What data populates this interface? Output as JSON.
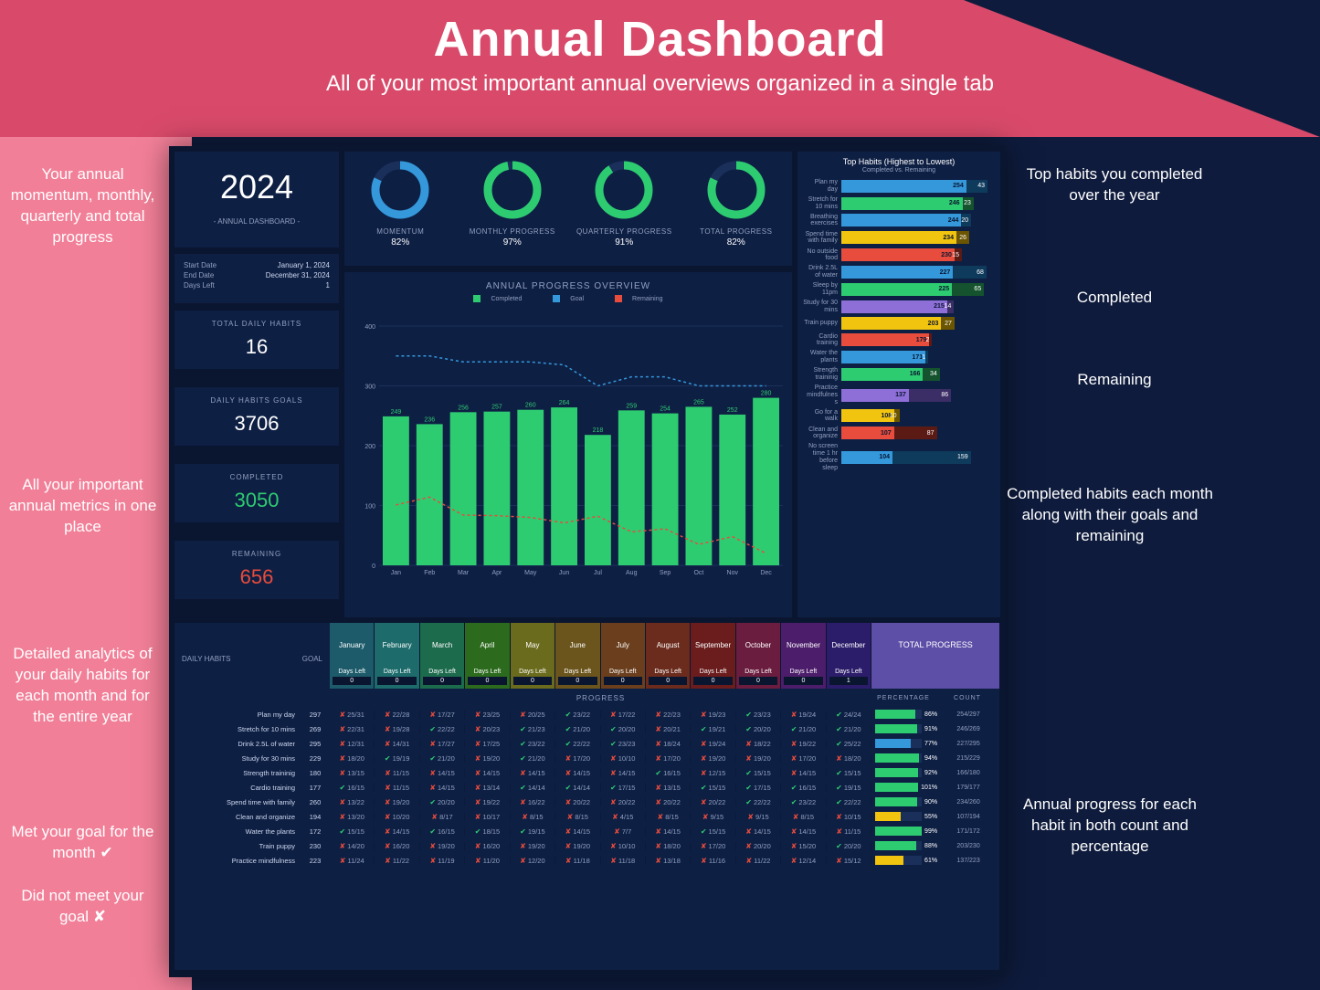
{
  "header": {
    "title": "Annual Dashboard",
    "subtitle": "All of your most important annual overviews organized in a single tab"
  },
  "year_panel": {
    "year": "2024",
    "subtitle": "- ANNUAL DASHBOARD -"
  },
  "dates": {
    "start_label": "Start Date",
    "start_value": "January 1, 2024",
    "end_label": "End Date",
    "end_value": "December 31, 2024",
    "days_left_label": "Days Left",
    "days_left_value": "1"
  },
  "metrics": [
    {
      "label": "TOTAL DAILY HABITS",
      "value": "16",
      "color": "#ffffff"
    },
    {
      "label": "DAILY HABITS GOALS",
      "value": "3706",
      "color": "#ffffff"
    },
    {
      "label": "COMPLETED",
      "value": "3050",
      "color": "#2ecc71"
    },
    {
      "label": "REMAINING",
      "value": "656",
      "color": "#e74c3c"
    }
  ],
  "donuts": [
    {
      "label": "MOMENTUM",
      "value": "82%",
      "pct": 82,
      "color": "#3498db"
    },
    {
      "label": "MONTHLY PROGRESS",
      "value": "97%",
      "pct": 97,
      "color": "#2ecc71"
    },
    {
      "label": "QUARTERLY PROGRESS",
      "value": "91%",
      "pct": 91,
      "color": "#2ecc71"
    },
    {
      "label": "TOTAL PROGRESS",
      "value": "82%",
      "pct": 82,
      "color": "#2ecc71"
    }
  ],
  "chart_data": {
    "type": "bar",
    "title": "ANNUAL PROGRESS OVERVIEW",
    "legend": [
      "Completed",
      "Goal",
      "Remaining"
    ],
    "categories": [
      "Jan",
      "Feb",
      "Mar",
      "Apr",
      "May",
      "Jun",
      "Jul",
      "Aug",
      "Sep",
      "Oct",
      "Nov",
      "Dec"
    ],
    "series": [
      {
        "name": "Completed",
        "color": "#2ecc71",
        "values": [
          249,
          236,
          256,
          257,
          260,
          264,
          218,
          259,
          254,
          265,
          252,
          280
        ]
      },
      {
        "name": "Goal",
        "color": "#3498db",
        "values": [
          350,
          350,
          340,
          340,
          340,
          335,
          300,
          315,
          315,
          300,
          300,
          300
        ]
      },
      {
        "name": "Remaining",
        "color": "#e74c3c",
        "values": [
          101,
          114,
          84,
          83,
          80,
          71,
          82,
          56,
          61,
          35,
          48,
          20
        ]
      }
    ],
    "ylim": [
      0,
      400
    ],
    "yticks": [
      0,
      100,
      200,
      300,
      400
    ]
  },
  "top_habits": {
    "title": "Top Habits (Highest to Lowest)",
    "subtitle": "Completed vs. Remaining",
    "rows": [
      {
        "label": "Plan my day",
        "completed": 254,
        "remaining": 43,
        "c1": "#3498db",
        "c2": "#0e3a5c"
      },
      {
        "label": "Stretch for 10 mins",
        "completed": 246,
        "remaining": 23,
        "c1": "#2ecc71",
        "c2": "#14532d"
      },
      {
        "label": "Breathing exercises",
        "completed": 244,
        "remaining": 20,
        "c1": "#3498db",
        "c2": "#0e3a5c"
      },
      {
        "label": "Spend time with family",
        "completed": 234,
        "remaining": 26,
        "c1": "#f1c40f",
        "c2": "#6b5500"
      },
      {
        "label": "No outside food",
        "completed": 230,
        "remaining": 15,
        "c1": "#e74c3c",
        "c2": "#5c1a14"
      },
      {
        "label": "Drink 2.5L of water",
        "completed": 227,
        "remaining": 68,
        "c1": "#3498db",
        "c2": "#0e3a5c"
      },
      {
        "label": "Sleep by 11pm",
        "completed": 225,
        "remaining": 65,
        "c1": "#2ecc71",
        "c2": "#14532d"
      },
      {
        "label": "Study for 30 mins",
        "completed": 215,
        "remaining": 14,
        "c1": "#8e6fd8",
        "c2": "#3b2d66"
      },
      {
        "label": "Train puppy",
        "completed": 203,
        "remaining": 27,
        "c1": "#f1c40f",
        "c2": "#6b5500"
      },
      {
        "label": "Cardio training",
        "completed": 179,
        "remaining": 2,
        "c1": "#e74c3c",
        "c2": "#5c1a14"
      },
      {
        "label": "Water the plants",
        "completed": 171,
        "remaining": 1,
        "c1": "#3498db",
        "c2": "#0e3a5c"
      },
      {
        "label": "Strength traininig",
        "completed": 166,
        "remaining": 34,
        "c1": "#2ecc71",
        "c2": "#14532d"
      },
      {
        "label": "Practice mindfulnes s",
        "completed": 137,
        "remaining": 86,
        "c1": "#8e6fd8",
        "c2": "#3b2d66"
      },
      {
        "label": "Go for a walk",
        "completed": 108,
        "remaining": 10,
        "c1": "#f1c40f",
        "c2": "#6b5500"
      },
      {
        "label": "Clean and organize",
        "completed": 107,
        "remaining": 87,
        "c1": "#e74c3c",
        "c2": "#5c1a14"
      },
      {
        "label": "No screen time 1 hr before sleep",
        "completed": 104,
        "remaining": 159,
        "c1": "#3498db",
        "c2": "#0e3a5c"
      }
    ]
  },
  "month_headers": {
    "months": [
      "January",
      "February",
      "March",
      "April",
      "May",
      "June",
      "July",
      "August",
      "September",
      "October",
      "November",
      "December"
    ],
    "colors": [
      "#1d5b6b",
      "#1d6b6b",
      "#1d6b4d",
      "#2c6b1d",
      "#6b6b1d",
      "#6b551d",
      "#6b3f1d",
      "#6b2c1d",
      "#6b1d1d",
      "#6b1d3f",
      "#4c1d6b",
      "#2c1d6b"
    ],
    "days_left_label": "Days Left",
    "days_left": [
      "0",
      "0",
      "0",
      "0",
      "0",
      "0",
      "0",
      "0",
      "0",
      "0",
      "0",
      "1"
    ],
    "left_label": "DAILY HABITS",
    "goal_label": "GOAL",
    "total_label": "TOTAL PROGRESS",
    "progress_label": "PROGRESS",
    "pct_label": "PERCENTAGE",
    "count_label": "COUNT"
  },
  "habit_rows": [
    {
      "name": "Plan my day",
      "goal": 297,
      "cells": [
        [
          "x",
          "25/31"
        ],
        [
          "x",
          "22/28"
        ],
        [
          "x",
          "17/27"
        ],
        [
          "x",
          "23/25"
        ],
        [
          "x",
          "20/25"
        ],
        [
          "v",
          "23/22"
        ],
        [
          "x",
          "17/22"
        ],
        [
          "x",
          "22/23"
        ],
        [
          "x",
          "19/23"
        ],
        [
          "v",
          "23/23"
        ],
        [
          "x",
          "19/24"
        ],
        [
          "v",
          "24/24"
        ]
      ],
      "pct": 86,
      "count": "254/297"
    },
    {
      "name": "Stretch for 10 mins",
      "goal": 269,
      "cells": [
        [
          "x",
          "22/31"
        ],
        [
          "x",
          "19/28"
        ],
        [
          "v",
          "22/22"
        ],
        [
          "x",
          "20/23"
        ],
        [
          "v",
          "21/23"
        ],
        [
          "v",
          "21/20"
        ],
        [
          "v",
          "20/20"
        ],
        [
          "x",
          "20/21"
        ],
        [
          "v",
          "19/21"
        ],
        [
          "v",
          "20/20"
        ],
        [
          "v",
          "21/20"
        ],
        [
          "v",
          "21/20"
        ]
      ],
      "pct": 91,
      "count": "246/269"
    },
    {
      "name": "Drink 2.5L of water",
      "goal": 295,
      "cells": [
        [
          "x",
          "12/31"
        ],
        [
          "x",
          "14/31"
        ],
        [
          "x",
          "17/27"
        ],
        [
          "x",
          "17/25"
        ],
        [
          "v",
          "23/22"
        ],
        [
          "v",
          "22/22"
        ],
        [
          "v",
          "23/23"
        ],
        [
          "x",
          "18/24"
        ],
        [
          "x",
          "19/24"
        ],
        [
          "x",
          "18/22"
        ],
        [
          "x",
          "19/22"
        ],
        [
          "v",
          "25/22"
        ]
      ],
      "pct": 77,
      "count": "227/295"
    },
    {
      "name": "Study for 30 mins",
      "goal": 229,
      "cells": [
        [
          "x",
          "18/20"
        ],
        [
          "v",
          "19/19"
        ],
        [
          "v",
          "21/20"
        ],
        [
          "x",
          "19/20"
        ],
        [
          "v",
          "21/20"
        ],
        [
          "x",
          "17/20"
        ],
        [
          "x",
          "10/10"
        ],
        [
          "x",
          "17/20"
        ],
        [
          "x",
          "19/20"
        ],
        [
          "x",
          "19/20"
        ],
        [
          "x",
          "17/20"
        ],
        [
          "x",
          "18/20"
        ]
      ],
      "pct": 94,
      "count": "215/229"
    },
    {
      "name": "Strength traininig",
      "goal": 180,
      "cells": [
        [
          "x",
          "13/15"
        ],
        [
          "x",
          "11/15"
        ],
        [
          "x",
          "14/15"
        ],
        [
          "x",
          "14/15"
        ],
        [
          "x",
          "14/15"
        ],
        [
          "x",
          "14/15"
        ],
        [
          "x",
          "14/15"
        ],
        [
          "v",
          "16/15"
        ],
        [
          "x",
          "12/15"
        ],
        [
          "v",
          "15/15"
        ],
        [
          "x",
          "14/15"
        ],
        [
          "v",
          "15/15"
        ]
      ],
      "pct": 92,
      "count": "166/180"
    },
    {
      "name": "Cardio training",
      "goal": 177,
      "cells": [
        [
          "v",
          "16/15"
        ],
        [
          "x",
          "11/15"
        ],
        [
          "x",
          "14/15"
        ],
        [
          "x",
          "13/14"
        ],
        [
          "v",
          "14/14"
        ],
        [
          "v",
          "14/14"
        ],
        [
          "v",
          "17/15"
        ],
        [
          "x",
          "13/15"
        ],
        [
          "v",
          "15/15"
        ],
        [
          "v",
          "17/15"
        ],
        [
          "v",
          "16/15"
        ],
        [
          "v",
          "19/15"
        ]
      ],
      "pct": 101,
      "count": "179/177"
    },
    {
      "name": "Spend time with family",
      "goal": 260,
      "cells": [
        [
          "x",
          "13/22"
        ],
        [
          "x",
          "19/20"
        ],
        [
          "v",
          "20/20"
        ],
        [
          "x",
          "19/22"
        ],
        [
          "x",
          "16/22"
        ],
        [
          "x",
          "20/22"
        ],
        [
          "x",
          "20/22"
        ],
        [
          "x",
          "20/22"
        ],
        [
          "x",
          "20/22"
        ],
        [
          "v",
          "22/22"
        ],
        [
          "v",
          "23/22"
        ],
        [
          "v",
          "22/22"
        ]
      ],
      "pct": 90,
      "count": "234/260"
    },
    {
      "name": "Clean and organize",
      "goal": 194,
      "cells": [
        [
          "x",
          "13/20"
        ],
        [
          "x",
          "10/20"
        ],
        [
          "x",
          "8/17"
        ],
        [
          "x",
          "10/17"
        ],
        [
          "x",
          "8/15"
        ],
        [
          "x",
          "8/15"
        ],
        [
          "x",
          "4/15"
        ],
        [
          "x",
          "8/15"
        ],
        [
          "x",
          "9/15"
        ],
        [
          "x",
          "9/15"
        ],
        [
          "x",
          "8/15"
        ],
        [
          "x",
          "10/15"
        ]
      ],
      "pct": 55,
      "count": "107/194"
    },
    {
      "name": "Water the plants",
      "goal": 172,
      "cells": [
        [
          "v",
          "15/15"
        ],
        [
          "x",
          "14/15"
        ],
        [
          "v",
          "16/15"
        ],
        [
          "v",
          "18/15"
        ],
        [
          "v",
          "19/15"
        ],
        [
          "x",
          "14/15"
        ],
        [
          "x",
          "7/7"
        ],
        [
          "x",
          "14/15"
        ],
        [
          "v",
          "15/15"
        ],
        [
          "x",
          "14/15"
        ],
        [
          "x",
          "14/15"
        ],
        [
          "x",
          "11/15"
        ]
      ],
      "pct": 99,
      "count": "171/172"
    },
    {
      "name": "Train puppy",
      "goal": 230,
      "cells": [
        [
          "x",
          "14/20"
        ],
        [
          "x",
          "16/20"
        ],
        [
          "x",
          "19/20"
        ],
        [
          "x",
          "16/20"
        ],
        [
          "x",
          "19/20"
        ],
        [
          "x",
          "19/20"
        ],
        [
          "x",
          "10/10"
        ],
        [
          "x",
          "18/20"
        ],
        [
          "x",
          "17/20"
        ],
        [
          "x",
          "20/20"
        ],
        [
          "x",
          "15/20"
        ],
        [
          "v",
          "20/20"
        ]
      ],
      "pct": 88,
      "count": "203/230"
    },
    {
      "name": "Practice mindfulness",
      "goal": 223,
      "cells": [
        [
          "x",
          "11/24"
        ],
        [
          "x",
          "11/22"
        ],
        [
          "x",
          "11/19"
        ],
        [
          "x",
          "11/20"
        ],
        [
          "x",
          "12/20"
        ],
        [
          "x",
          "11/18"
        ],
        [
          "x",
          "11/18"
        ],
        [
          "x",
          "13/18"
        ],
        [
          "x",
          "11/16"
        ],
        [
          "x",
          "11/22"
        ],
        [
          "x",
          "12/14"
        ],
        [
          "x",
          "15/12"
        ]
      ],
      "pct": 61,
      "count": "137/223"
    }
  ],
  "callouts": {
    "c1": "Your annual momentum, monthly, quarterly and total progress",
    "c2": "All your important annual metrics in one place",
    "c3": "Detailed analytics of your daily habits for each month and for the entire year",
    "c4": "Met your goal for the month ✔",
    "c5": "Did not meet your goal ✘",
    "c6": "Top habits you completed over the year",
    "c7": "Completed",
    "c8": "Remaining",
    "c9": "Completed habits each month along with their goals and remaining",
    "c10": "Annual progress for each habit in both count and percentage"
  }
}
